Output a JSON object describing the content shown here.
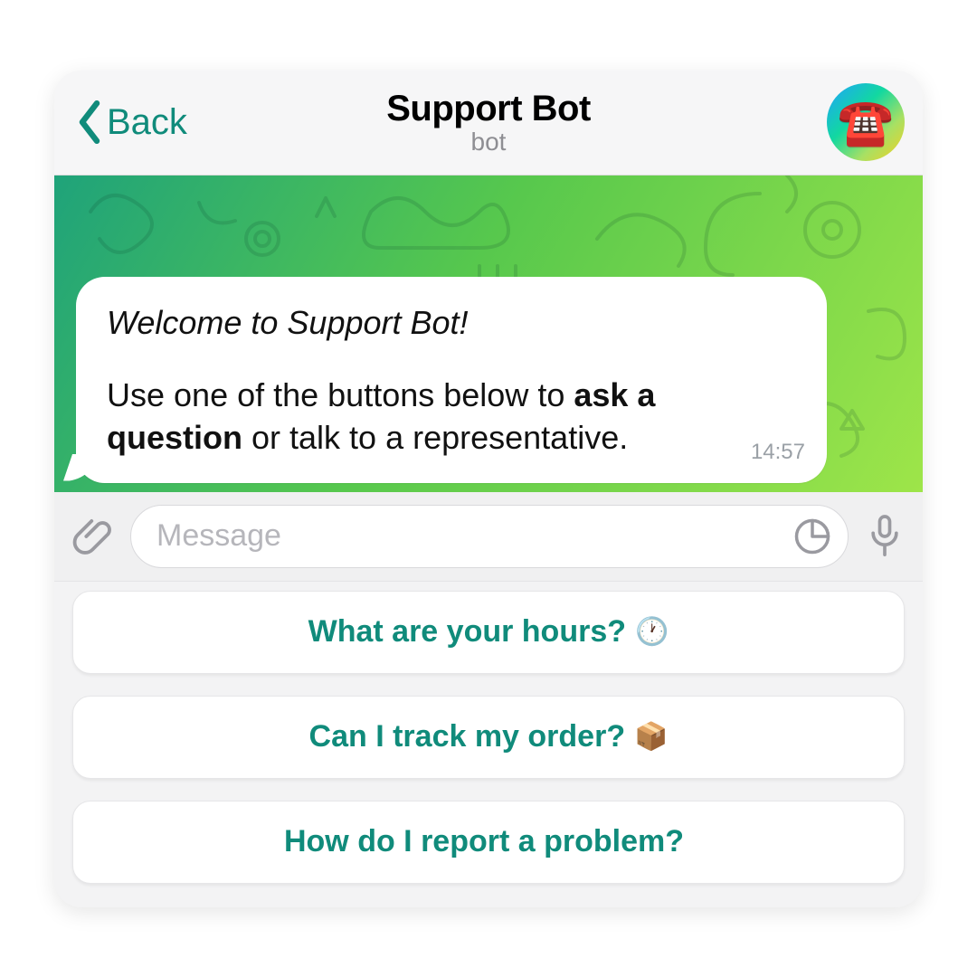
{
  "header": {
    "back_label": "Back",
    "title": "Support Bot",
    "subtitle": "bot",
    "avatar_emoji": "☎️"
  },
  "message": {
    "welcome_italic": "Welcome to Support Bot!",
    "body_prefix": "Use one of the buttons below to ",
    "body_bold": "ask a question",
    "body_suffix": " or talk to a representative.",
    "time": "14:57"
  },
  "composer": {
    "placeholder": "Message"
  },
  "quick_replies": [
    {
      "label": "What are your hours?",
      "emoji": "🕐"
    },
    {
      "label": "Can I track my order?",
      "emoji": "📦"
    },
    {
      "label": "How do I report a problem?",
      "emoji": ""
    }
  ]
}
